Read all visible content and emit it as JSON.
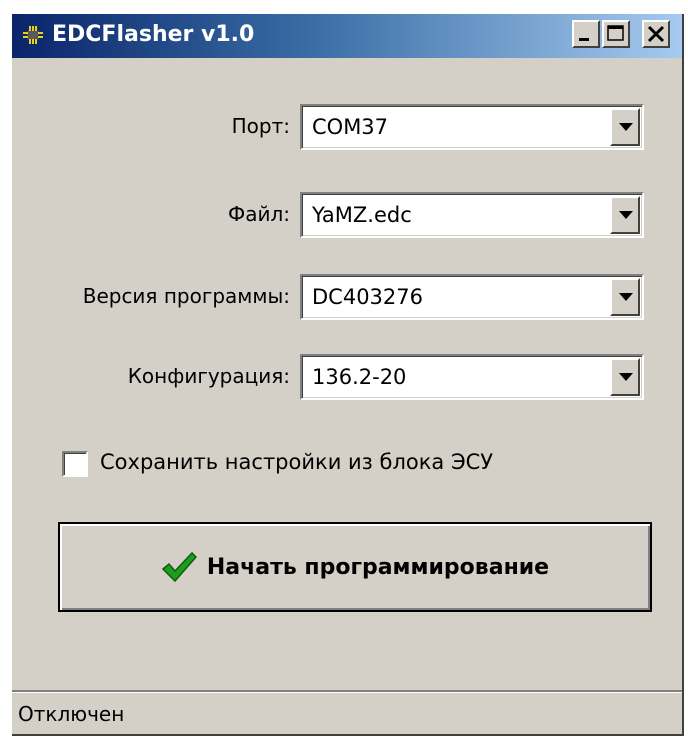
{
  "window": {
    "title": "EDCFlasher v1.0",
    "controls": {
      "minimize": "minimize-icon",
      "maximize": "maximize-icon",
      "close": "close-icon"
    }
  },
  "form": {
    "port": {
      "label": "Порт:",
      "value": "COM37"
    },
    "file": {
      "label": "Файл:",
      "value": "YaMZ.edc"
    },
    "version": {
      "label": "Версия программы:",
      "value": "DC403276"
    },
    "config": {
      "label": "Конфигурация:",
      "value": "136.2-20"
    }
  },
  "save_settings": {
    "label": "Сохранить настройки из блока ЭСУ",
    "checked": false
  },
  "start_button": {
    "label": "Начать программирование",
    "icon": "checkmark-icon",
    "icon_color": "#1e9e1e"
  },
  "status": {
    "text": "Отключен"
  },
  "colors": {
    "titlebar_start": "#0a246a",
    "titlebar_end": "#a6caf0",
    "face": "#d4d0c8"
  }
}
